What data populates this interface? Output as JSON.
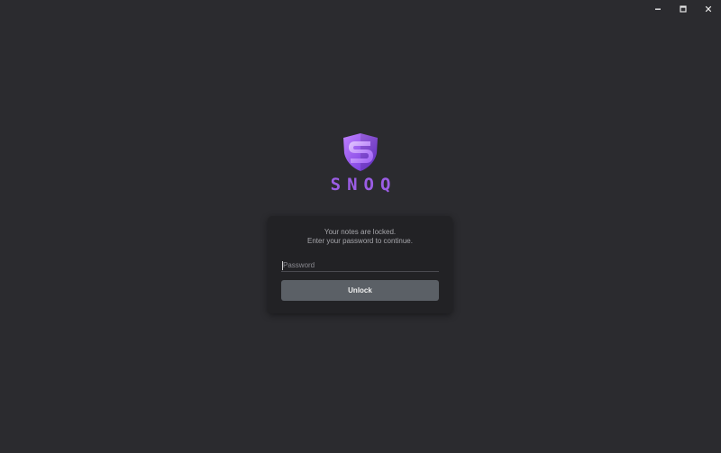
{
  "app": {
    "brand_name": "SNOQ"
  },
  "colors": {
    "background": "#2b2b2f",
    "card": "#222225",
    "accent": "#9b5de5",
    "button": "#5b6066"
  },
  "window_controls": {
    "minimize_icon": "minimize-icon",
    "maximize_icon": "maximize-icon",
    "close_icon": "close-icon"
  },
  "lock_screen": {
    "message_line1": "Your notes are locked.",
    "message_line2": "Enter your password to continue.",
    "password_placeholder": "Password",
    "password_value": "",
    "unlock_label": "Unlock"
  }
}
